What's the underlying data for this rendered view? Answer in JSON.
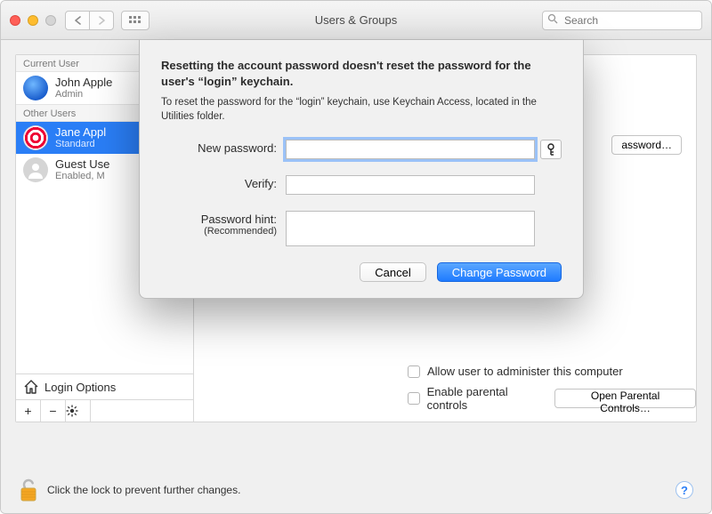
{
  "window": {
    "title": "Users & Groups",
    "search_placeholder": "Search"
  },
  "sidebar": {
    "current_header": "Current User",
    "other_header": "Other Users",
    "current_user": {
      "name": "John Apple",
      "role": "Admin"
    },
    "other_users": [
      {
        "name": "Jane Appl",
        "role": "Standard",
        "selected": true
      },
      {
        "name": "Guest Use",
        "role": "Enabled, M",
        "selected": false
      }
    ],
    "login_options_label": "Login Options"
  },
  "rightpane": {
    "reset_password_button": "assword…",
    "admin_checkbox_label": "Allow user to administer this computer",
    "parental_checkbox_label": "Enable parental controls",
    "open_parental_button": "Open Parental Controls…"
  },
  "lockrow": {
    "text": "Click the lock to prevent further changes."
  },
  "dialog": {
    "heading": "Resetting the account password doesn't reset the password for the user's “login” keychain.",
    "body": "To reset the password for the “login” keychain, use Keychain Access, located in the Utilities folder.",
    "new_password_label": "New password:",
    "verify_label": "Verify:",
    "hint_label": "Password hint:",
    "hint_sub": "(Recommended)",
    "cancel": "Cancel",
    "change": "Change Password"
  }
}
